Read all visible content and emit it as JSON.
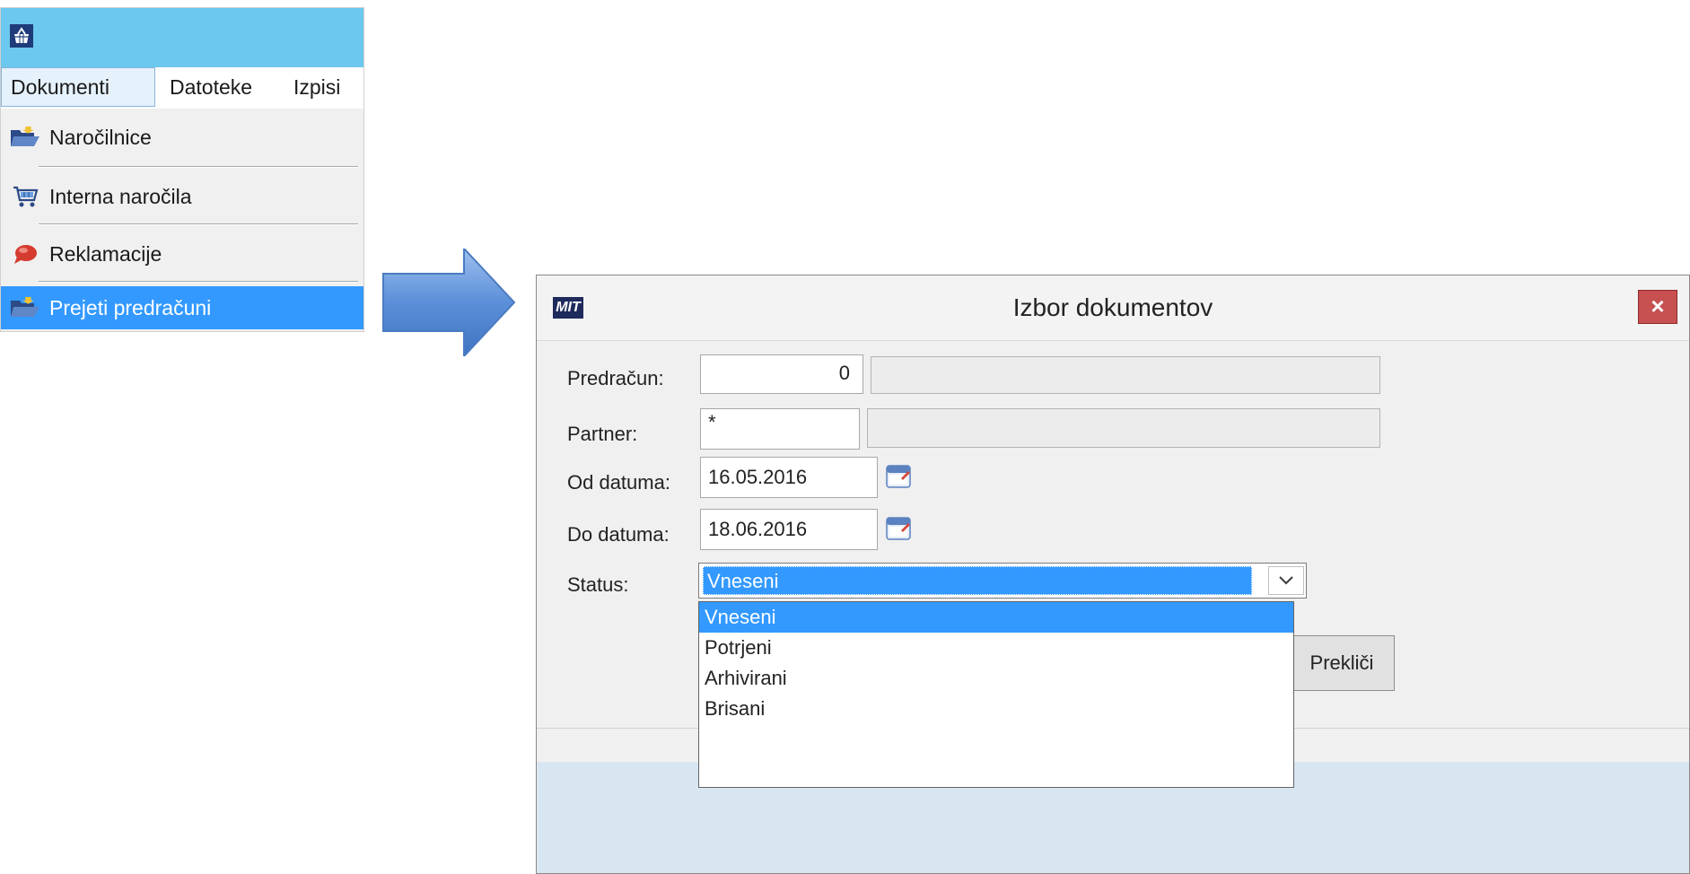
{
  "menu": {
    "bar_items": [
      {
        "label": "Dokumenti"
      },
      {
        "label": "Datoteke"
      },
      {
        "label": "Izpisi"
      }
    ],
    "items": [
      {
        "label": "Naročilnice",
        "icon": "folder-open-icon"
      },
      {
        "label": "Interna naročila",
        "icon": "shopping-cart-icon"
      },
      {
        "label": "Reklamacije",
        "icon": "speech-bubble-icon"
      },
      {
        "label": "Prejeti predračuni",
        "icon": "folder-open-icon",
        "highlighted": true
      }
    ]
  },
  "dialog": {
    "logo": "MIT",
    "title": "Izbor dokumentov",
    "close_label": "×",
    "fields": {
      "predracun": {
        "label": "Predračun:",
        "value": "0"
      },
      "partner": {
        "label": "Partner:",
        "value": "*"
      },
      "od_datuma": {
        "label": "Od datuma:",
        "value": "16.05.2016"
      },
      "do_datuma": {
        "label": "Do datuma:",
        "value": "18.06.2016"
      },
      "status": {
        "label": "Status:",
        "value": "Vneseni"
      }
    },
    "status_options": [
      "Vneseni",
      "Potrjeni",
      "Arhivirani",
      "Brisani"
    ],
    "cancel_label": "Prekliči"
  },
  "colors": {
    "titlebar": "#6cc8ee",
    "highlight": "#3399ff",
    "close_button": "#c75050",
    "arrow": "#5b8fd8"
  }
}
